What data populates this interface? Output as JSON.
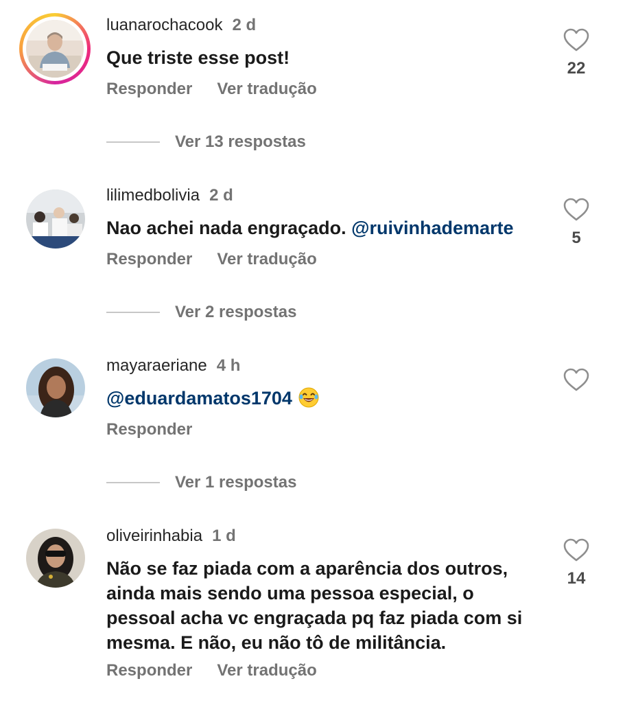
{
  "comments": [
    {
      "username": "luanarochacook",
      "time": "2 d",
      "text": "Que triste esse post!",
      "reply_label": "Responder",
      "translate_label": "Ver tradução",
      "likes": "22",
      "view_replies": "Ver 13 respostas",
      "has_story": true
    },
    {
      "username": "lilimedbolivia",
      "time": "2 d",
      "text": "Nao achei nada engraçado.",
      "mention": "@ruivinhademarte",
      "reply_label": "Responder",
      "translate_label": "Ver tradução",
      "likes": "5",
      "view_replies": "Ver 2 respostas"
    },
    {
      "username": "mayaraeriane",
      "time": "4 h",
      "mention": "@eduardamatos1704",
      "emoji": "laughing-tears",
      "reply_label": "Responder",
      "view_replies": "Ver 1 respostas"
    },
    {
      "username": "oliveirinhabia",
      "time": "1 d",
      "text": "Não se faz piada com a aparência dos outros, ainda mais sendo uma pessoa especial, o pessoal acha vc engraçada pq faz piada com si mesma. E não, eu não tô de militância.",
      "reply_label": "Responder",
      "translate_label": "Ver tradução",
      "likes": "14"
    }
  ],
  "colors": {
    "mention": "#00376b",
    "secondary_text": "#737373",
    "primary_text": "#262626"
  }
}
